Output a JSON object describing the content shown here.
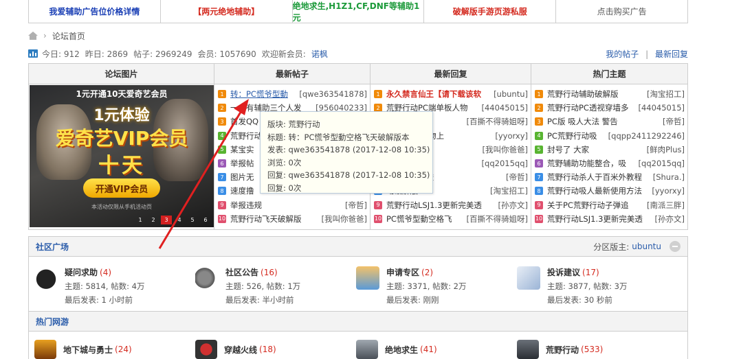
{
  "adbar": [
    {
      "text": "我爱辅助广告位价格详情",
      "color": "#1a3fb5"
    },
    {
      "text": "【两元绝地辅助】",
      "color": "#d42a1f"
    },
    {
      "text": "绝地求生,H1Z1,CF,DNF等辅助1元",
      "color": "#1c9a3a"
    },
    {
      "text": "破解版手游页游私服",
      "color": "#d42a1f"
    },
    {
      "text": "点击购买广告",
      "color": "#555"
    }
  ],
  "breadcrumb": {
    "page": "论坛首页"
  },
  "stats": {
    "today": "今日: 912",
    "yesterday": "昨日: 2869",
    "posts": "帖子: 2969249",
    "members": "会员: 1057690",
    "welcome": "欢迎新会员:",
    "new_user": "诺枫",
    "my_posts": "我的帖子",
    "latest_reply": "最新回复"
  },
  "grid": {
    "headers": [
      "论坛图片",
      "最新帖子",
      "最新回复",
      "热门主题"
    ],
    "banner": {
      "top": "1元开通10天爱奇艺会员",
      "line1": "1元体验",
      "line2": "爱奇艺VIP会员",
      "line3": "十天",
      "button": "开通VIP会员",
      "foot": "本活动仅限从手机活动页",
      "pages": [
        "1",
        "2",
        "3",
        "4",
        "5",
        "6"
      ],
      "active_page": "3"
    },
    "latest_posts": [
      {
        "n": "1",
        "title": "转：PC慌爷型動",
        "author": "[qwe363541878]"
      },
      {
        "n": "2",
        "title": "一个有辅助三个人发",
        "author": "[956040233]"
      },
      {
        "n": "3",
        "title": "首发QQ",
        "author": ""
      },
      {
        "n": "4",
        "title": "荒野行动",
        "author": ""
      },
      {
        "n": "5",
        "title": "某宝实",
        "author": ""
      },
      {
        "n": "6",
        "title": "举报帖",
        "author": ""
      },
      {
        "n": "7",
        "title": "图片无",
        "author": ""
      },
      {
        "n": "8",
        "title": "速度撸",
        "author": ""
      },
      {
        "n": "9",
        "title": "举报违规",
        "author": "[帝哲]"
      },
      {
        "n": "10",
        "title": "荒野行动飞天破解版",
        "author": "[我叫你爸爸]"
      }
    ],
    "latest_replies": [
      {
        "n": "1",
        "title": "永久禁言仙王【请下载该软",
        "author": "[ubuntu]"
      },
      {
        "n": "2",
        "title": "荒野行动PC端单板人物",
        "author": "[44045015]"
      },
      {
        "n": "3",
        "title": "空格飞",
        "author": "[百撕不得骑姐呀]"
      },
      {
        "n": "4",
        "title": "荒野行动 人物上",
        "author": "[yyorxy]"
      },
      {
        "n": "5",
        "title": "天破解版",
        "author": "[我叫你爸爸]"
      },
      {
        "n": "6",
        "title": "整合，吸",
        "author": "[qq2015qq]"
      },
      {
        "n": "7",
        "title": "天外加外置透",
        "author": "[帝哲]"
      },
      {
        "n": "8",
        "title": "动破解版",
        "author": "[淘宝招工]"
      },
      {
        "n": "9",
        "title": "荒野行动LSJ1.3更新完美透",
        "author": "[孙亦文]"
      },
      {
        "n": "10",
        "title": "PC慌爷型動空格飞",
        "author": "[百撕不得骑姐呀]"
      }
    ],
    "hot_topics": [
      {
        "n": "1",
        "title": "荒野行动辅助破解版",
        "author": "[淘宝招工]"
      },
      {
        "n": "2",
        "title": "荒野行动PC透视穿墙多",
        "author": "[44045015]"
      },
      {
        "n": "3",
        "title": "PC版 吸人大法 警告",
        "author": "[帝哲]"
      },
      {
        "n": "4",
        "title": "PC荒野行动吸",
        "author": "[qqpp2411292246]"
      },
      {
        "n": "5",
        "title": "封号了 大家",
        "author": "[鲜肉Plus]"
      },
      {
        "n": "6",
        "title": "荒野辅助功能整合，吸",
        "author": "[qq2015qq]"
      },
      {
        "n": "7",
        "title": "荒野行动杀人于百米外教程",
        "author": "[Shura.]"
      },
      {
        "n": "8",
        "title": "荒野行动吸人最新使用方法",
        "author": "[yyorxy]"
      },
      {
        "n": "9",
        "title": "关于PC荒野行动子弹追",
        "author": "[南派三胖]"
      },
      {
        "n": "10",
        "title": "荒野行动LSJ1.3更新完美透",
        "author": "[孙亦文]"
      }
    ]
  },
  "tooltip": {
    "board": "版块: 荒野行动",
    "title": "标题: 转：PC慌爷型動空格飞天破解版本",
    "posted": "发表: qwe363541878 (2017-12-08 10:35)",
    "views": "浏览: 0次",
    "reply": "回复: qwe363541878 (2017-12-08 10:35)",
    "replies": "回复: 0次"
  },
  "community": {
    "title": "社区广场",
    "moderator_label": "分区版主:",
    "moderator": "ubuntu",
    "forums": [
      {
        "name": "疑问求助",
        "count": "(4)",
        "stats": "主题: 5814, 帖数: 4万",
        "last": "最后发表: 1 小时前"
      },
      {
        "name": "社区公告",
        "count": "(16)",
        "stats": "主题: 526, 帖数: 1万",
        "last": "最后发表: 半小时前"
      },
      {
        "name": "申请专区",
        "count": "(2)",
        "stats": "主题: 3371, 帖数: 2万",
        "last": "最后发表: 刚刚"
      },
      {
        "name": "投诉建议",
        "count": "(17)",
        "stats": "主题: 3877, 帖数: 3万",
        "last": "最后发表: 30 秒前"
      }
    ]
  },
  "games": {
    "title": "热门网游",
    "forums": [
      {
        "name": "地下城与勇士",
        "count": "(24)"
      },
      {
        "name": "穿越火线",
        "count": "(18)"
      },
      {
        "name": "绝地求生",
        "count": "(41)"
      },
      {
        "name": "荒野行动",
        "count": "(533)"
      }
    ]
  },
  "badge_colors": [
    "#f08a0a",
    "#f08a0a",
    "#f08a0a",
    "#58b431",
    "#58b431",
    "#9b59b6",
    "#3a8ee6",
    "#3a8ee6",
    "#e0506e",
    "#e0506e"
  ],
  "colors": {
    "link": "#2a5caa",
    "hot": "#d42a1f",
    "annotation_arrow": "#e02020"
  }
}
